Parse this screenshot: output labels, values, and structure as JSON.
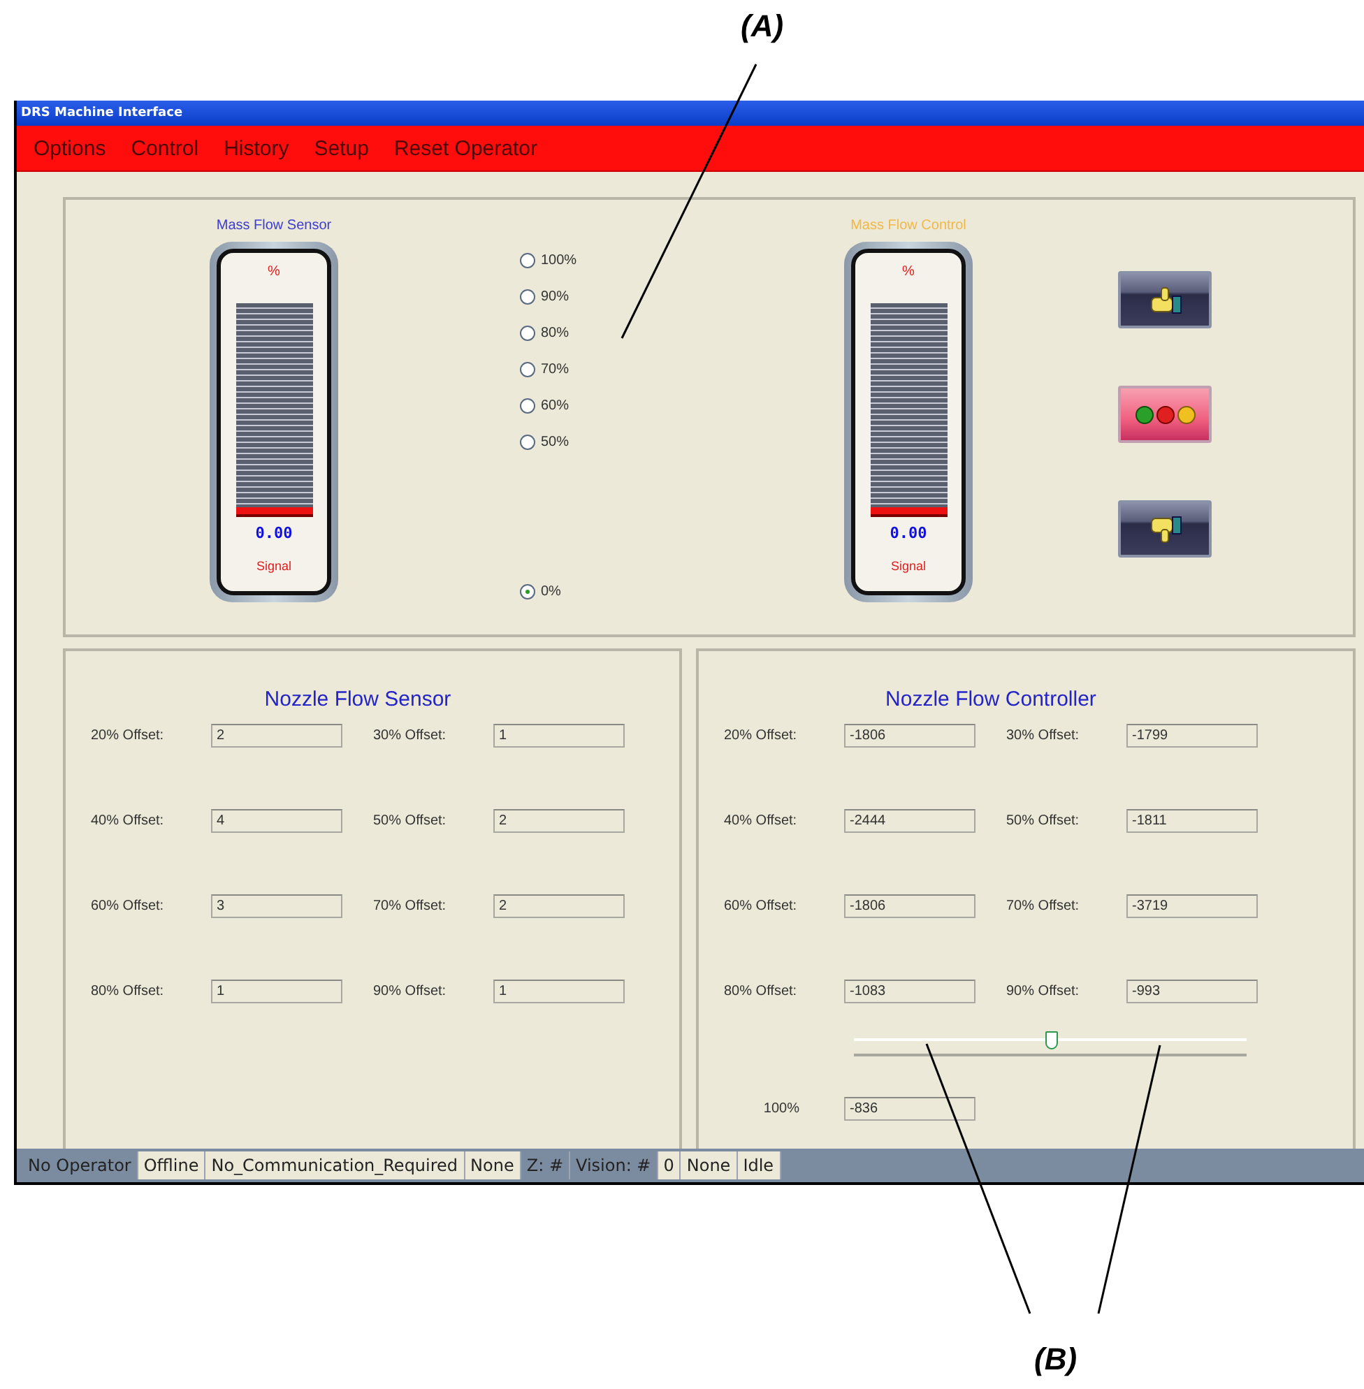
{
  "window": {
    "title": "DRS Machine Interface"
  },
  "menu": [
    "Options",
    "Control",
    "History",
    "Setup",
    "Reset Operator"
  ],
  "top_panel": {
    "gauges": [
      {
        "title": "Mass Flow Sensor",
        "color": "#3c3cd2",
        "unit": "%",
        "value": "0.00",
        "caption": "Signal",
        "level": 0
      },
      {
        "title": "Mass Flow Control",
        "color": "#f0b848",
        "unit": "%",
        "value": "0.00",
        "caption": "Signal",
        "level": 0
      }
    ],
    "radio_options": [
      {
        "label": "100%",
        "selected": false
      },
      {
        "label": "90%",
        "selected": false
      },
      {
        "label": "80%",
        "selected": false
      },
      {
        "label": "70%",
        "selected": false
      },
      {
        "label": "60%",
        "selected": false
      },
      {
        "label": "50%",
        "selected": false
      },
      {
        "label": "0%",
        "selected": true
      }
    ],
    "buttons": [
      {
        "kind": "thumbs_up"
      },
      {
        "kind": "lights"
      },
      {
        "kind": "thumbs_down"
      }
    ]
  },
  "nozzle_panels": [
    {
      "title": "Nozzle Flow Sensor",
      "fields": [
        {
          "label": "20% Offset:",
          "value": "2"
        },
        {
          "label": "30% Offset:",
          "value": "1"
        },
        {
          "label": "40% Offset:",
          "value": "4"
        },
        {
          "label": "50% Offset:",
          "value": "2"
        },
        {
          "label": "60% Offset:",
          "value": "3"
        },
        {
          "label": "70% Offset:",
          "value": "2"
        },
        {
          "label": "80% Offset:",
          "value": "1"
        },
        {
          "label": "90% Offset:",
          "value": "1"
        }
      ]
    },
    {
      "title": "Nozzle Flow Controller",
      "fields": [
        {
          "label": "20% Offset:",
          "value": "-1806"
        },
        {
          "label": "30% Offset:",
          "value": "-1799"
        },
        {
          "label": "40% Offset:",
          "value": "-2444"
        },
        {
          "label": "50% Offset:",
          "value": "-1811"
        },
        {
          "label": "60% Offset:",
          "value": "-1806"
        },
        {
          "label": "70% Offset:",
          "value": "-3719"
        },
        {
          "label": "80% Offset:",
          "value": "-1083"
        },
        {
          "label": "90% Offset:",
          "value": "-993"
        }
      ],
      "slider": {
        "level": 0.5
      },
      "extra_field": {
        "label": "100%",
        "value": "-836"
      }
    }
  ],
  "status_bar": [
    {
      "text": "No Operator",
      "highlighted": false
    },
    {
      "text": "Offline",
      "highlighted": true
    },
    {
      "text": "No_Communication_Required",
      "highlighted": true
    },
    {
      "text": "None",
      "highlighted": true
    },
    {
      "text": "Z: #",
      "highlighted": false
    },
    {
      "text": "Vision: #",
      "highlighted": false
    },
    {
      "text": "0",
      "highlighted": true
    },
    {
      "text": "None",
      "highlighted": true
    },
    {
      "text": "Idle",
      "highlighted": true
    }
  ],
  "annotations": [
    {
      "label": "(A)"
    },
    {
      "label": "(B)"
    }
  ]
}
